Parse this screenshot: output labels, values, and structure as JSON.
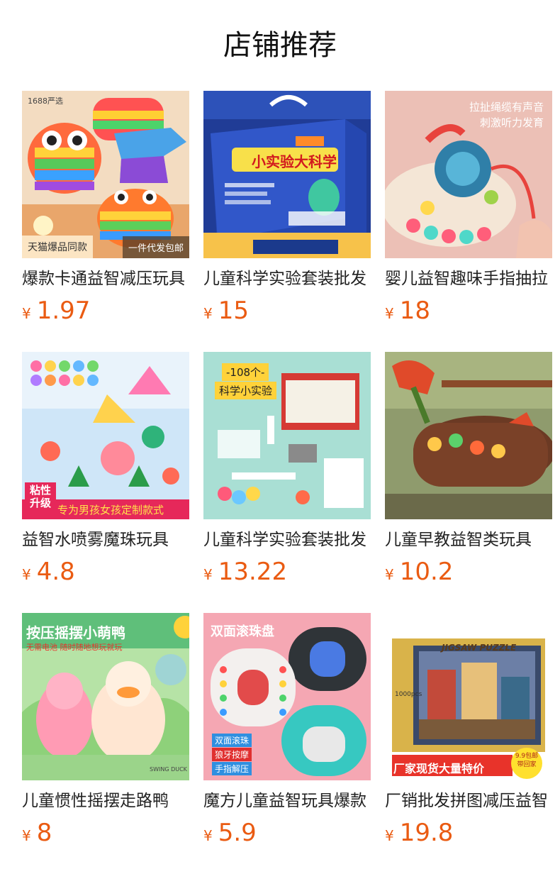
{
  "header": {
    "title": "店铺推荐"
  },
  "products": [
    {
      "name": "爆款卡通益智减压玩具",
      "currency": "¥",
      "price": "1.97",
      "badges": {
        "top_left": "1688严选",
        "bottom_left": "天猫爆品同款",
        "bottom_right": "一件代发包邮"
      },
      "icon": "pop-it-toy-icon"
    },
    {
      "name": "儿童科学实验套装批发",
      "currency": "¥",
      "price": "15",
      "badges": {
        "box_title": "小实验大科学"
      },
      "icon": "science-kit-box-icon"
    },
    {
      "name": "婴儿益智趣味手指抽拉",
      "currency": "¥",
      "price": "18",
      "badges": {
        "caption_1": "拉扯绳缆有声音",
        "caption_2": "刺激听力发育"
      },
      "icon": "pull-string-toy-icon"
    },
    {
      "name": "益智水喷雾魔珠玩具",
      "currency": "¥",
      "price": "4.8",
      "badges": {
        "corner": "粘性升级",
        "banner": "专为男孩女孩定制款式"
      },
      "icon": "water-beads-icon"
    },
    {
      "name": "儿童科学实验套装批发",
      "currency": "¥",
      "price": "13.22",
      "badges": {
        "tag_1": "-108个-",
        "tag_2": "科学小实验"
      },
      "icon": "experiment-set-icon"
    },
    {
      "name": "儿童早教益智类玩具",
      "currency": "¥",
      "price": "10.2",
      "badges": {},
      "icon": "woodpecker-toy-icon"
    },
    {
      "name": "儿童惯性摇摆走路鸭",
      "currency": "¥",
      "price": "8",
      "badges": {
        "headline": "按压摇摆小萌鸭",
        "sub": "无需电池 随时随地想玩就玩",
        "brand": "SWING DUCK"
      },
      "icon": "swing-duck-icon"
    },
    {
      "name": "魔方儿童益智玩具爆款",
      "currency": "¥",
      "price": "5.9",
      "badges": {
        "headline": "双面滚珠盘",
        "tag_1": "双面滚珠",
        "tag_2": "狼牙按摩",
        "tag_3": "手指解压"
      },
      "icon": "bead-puzzle-icon"
    },
    {
      "name": "厂销批发拼图减压益智",
      "currency": "¥",
      "price": "19.8",
      "badges": {
        "box_title": "JIGSAW PUZZLE",
        "banner": "厂家现货大量特价",
        "seal": "9.9包邮 带回家",
        "pieces": "1000pcs"
      },
      "icon": "jigsaw-puzzle-icon"
    }
  ],
  "colors": {
    "price": "#ea5b12",
    "text": "#222222"
  }
}
